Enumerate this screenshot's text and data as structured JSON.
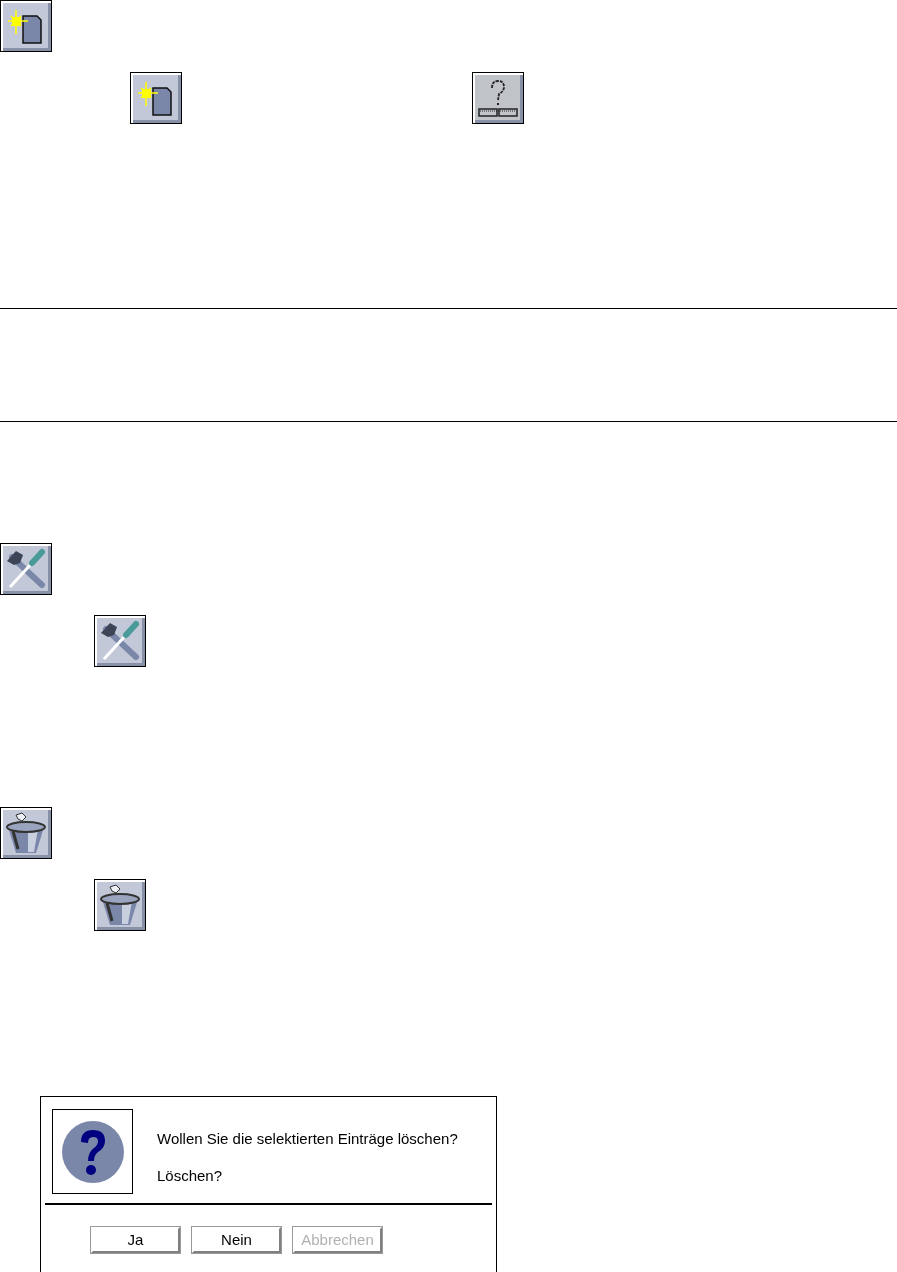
{
  "icon_rows": [
    {
      "items": [
        {
          "kind": "new-document"
        }
      ]
    },
    {
      "items": [
        {
          "kind": "new-document"
        },
        {
          "kind": "help"
        }
      ]
    },
    {
      "items": [
        {
          "kind": "tools"
        }
      ]
    },
    {
      "items": [
        {
          "kind": "tools"
        }
      ]
    },
    {
      "items": [
        {
          "kind": "bucket"
        }
      ]
    },
    {
      "items": [
        {
          "kind": "bucket"
        }
      ]
    }
  ],
  "dialog": {
    "message": "Wollen Sie die selektierten Einträge löschen?",
    "question": "Löschen?",
    "buttons": [
      {
        "label": "Ja",
        "disabled": false
      },
      {
        "label": "Nein",
        "disabled": false
      },
      {
        "label": "Abbrechen",
        "disabled": true
      }
    ]
  }
}
